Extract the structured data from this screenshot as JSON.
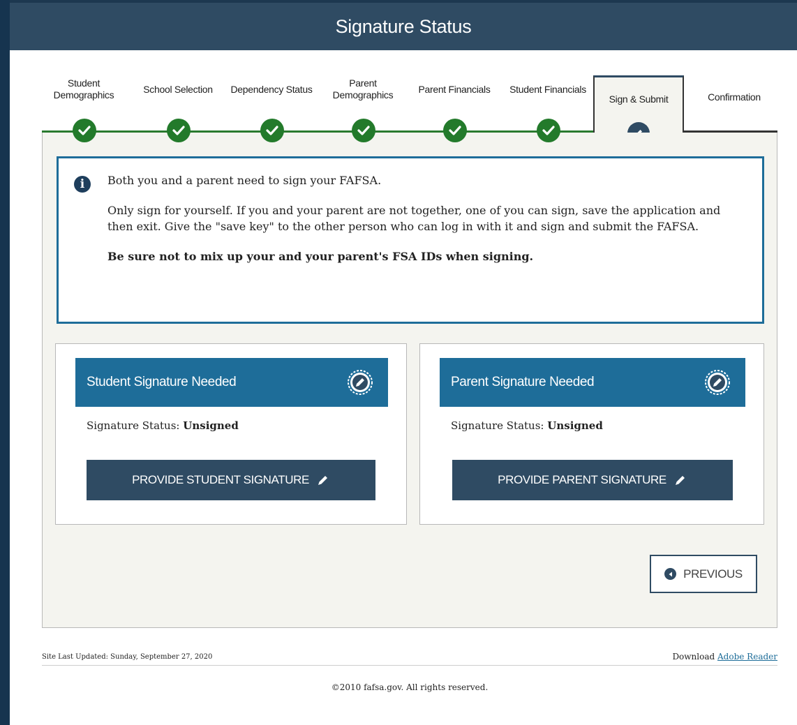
{
  "page": {
    "title": "Signature Status"
  },
  "steps": [
    {
      "label": "Student Demographics",
      "status": "complete"
    },
    {
      "label": "School Selection",
      "status": "complete"
    },
    {
      "label": "Dependency Status",
      "status": "complete"
    },
    {
      "label": "Parent Demographics",
      "status": "complete"
    },
    {
      "label": "Parent Financials",
      "status": "complete"
    },
    {
      "label": "Student Financials",
      "status": "complete"
    },
    {
      "label": "Sign & Submit",
      "status": "current"
    },
    {
      "label": "Confirmation",
      "status": "pending"
    }
  ],
  "info": {
    "line1": "Both you and a parent need to sign your FAFSA.",
    "line2": "Only sign for yourself. If you and your parent are not together, one of you can sign, save the application and then exit. Give the \"save key\" to the other person who can log in with it and sign and submit the FAFSA.",
    "line3": "Be sure not to mix up your and your parent's FSA IDs when signing."
  },
  "student": {
    "heading": "Student Signature Needed",
    "status_label": "Signature Status:",
    "status_value": "Unsigned",
    "button": "PROVIDE STUDENT SIGNATURE"
  },
  "parent": {
    "heading": "Parent Signature Needed",
    "status_label": "Signature Status:",
    "status_value": "Unsigned",
    "button": "PROVIDE PARENT SIGNATURE"
  },
  "nav": {
    "previous": "PREVIOUS"
  },
  "footer": {
    "updated": "Site Last Updated: Sunday, September 27, 2020",
    "download_prefix": "Download",
    "download_link": "Adobe Reader",
    "copyright": "©2010 fafsa.gov. All rights reserved."
  },
  "colors": {
    "header": "#2f4b63",
    "accent_blue": "#1e6d99",
    "complete_green": "#237a2b"
  }
}
